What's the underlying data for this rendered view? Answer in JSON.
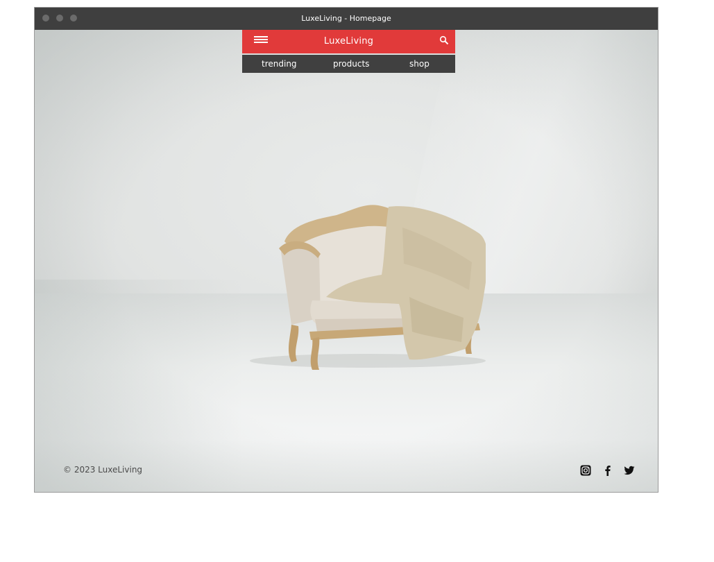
{
  "window": {
    "title": "LuxeLiving - Homepage"
  },
  "header": {
    "brand": "LuxeLiving",
    "menu_icon": "hamburger-menu-icon",
    "search_icon": "search-icon",
    "accent_color": "#e13a3a"
  },
  "nav": {
    "items": [
      {
        "label": "trending"
      },
      {
        "label": "products"
      },
      {
        "label": "shop"
      }
    ],
    "bg_color": "#404040"
  },
  "hero": {
    "image": "sofa-photo"
  },
  "footer": {
    "copyright": "© 2023 LuxeLiving",
    "social": [
      {
        "icon": "instagram-icon"
      },
      {
        "icon": "facebook-icon"
      },
      {
        "icon": "twitter-icon"
      }
    ]
  }
}
